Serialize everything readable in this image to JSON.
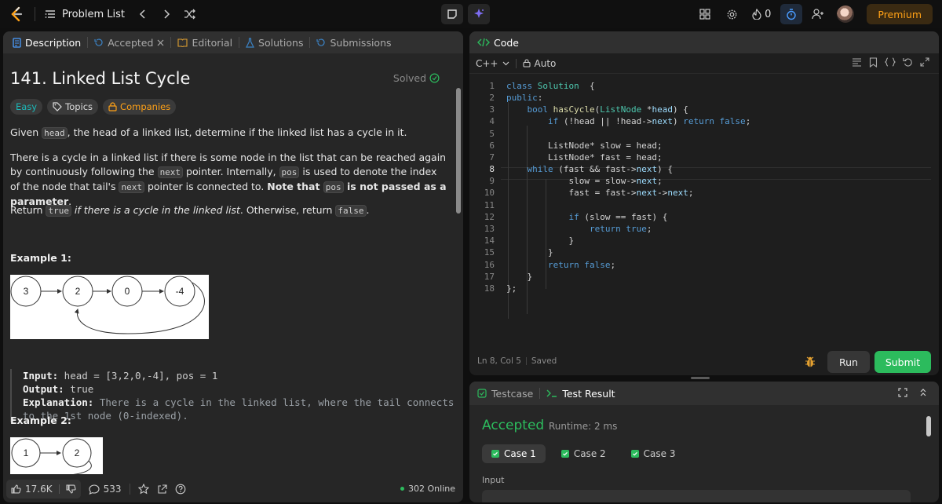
{
  "topbar": {
    "problem_list": "Problem List",
    "streak_count": "0",
    "premium": "Premium"
  },
  "tabs": [
    {
      "label": "Description"
    },
    {
      "label": "Accepted"
    },
    {
      "label": "Editorial"
    },
    {
      "label": "Solutions"
    },
    {
      "label": "Submissions"
    }
  ],
  "problem": {
    "title": "141. Linked List Cycle",
    "status": "Solved",
    "difficulty": "Easy",
    "topics": "Topics",
    "companies": "Companies",
    "desc1_a": "Given ",
    "desc1_code": "head",
    "desc1_b": ", the head of a linked list, determine if the linked list has a cycle in it.",
    "desc2_a": "There is a cycle in a linked list if there is some node in the list that can be reached again by continuously following the ",
    "desc2_code1": "next",
    "desc2_b": " pointer. Internally, ",
    "desc2_code2": "pos",
    "desc2_c": " is used to denote the index of the node that tail's ",
    "desc2_code3": "next",
    "desc2_d": " pointer is connected to. ",
    "desc2_bold1": "Note that ",
    "desc2_code4": "pos",
    "desc2_bold2": " is not passed as a parameter",
    "desc2_e": ".",
    "desc3_a": "Return ",
    "desc3_code1": "true",
    "desc3_italic": " if there is a cycle in the linked list",
    "desc3_b": ". Otherwise, return ",
    "desc3_code2": "false",
    "desc3_c": ".",
    "example1_title": "Example 1:",
    "example1_nodes": [
      "3",
      "2",
      "0",
      "-4"
    ],
    "example1_input_label": "Input:",
    "example1_input": " head = [3,2,0,-4], pos = 1",
    "example1_output_label": "Output:",
    "example1_output": " true",
    "example1_expl_label": "Explanation:",
    "example1_expl": " There is a cycle in the linked list, where the tail connects\nto the 1st node (0-indexed).",
    "example2_title": "Example 2:",
    "example2_nodes": [
      "1",
      "2"
    ]
  },
  "footer": {
    "likes": "17.6K",
    "comments": "533",
    "online": "302 Online"
  },
  "code_panel": {
    "title": "Code",
    "language": "C++",
    "mode": "Auto",
    "line_numbers": [
      "1",
      "2",
      "3",
      "4",
      "5",
      "6",
      "7",
      "8",
      "9",
      "10",
      "11",
      "12",
      "13",
      "14",
      "15",
      "16",
      "17",
      "18"
    ],
    "cursor": "Ln 8, Col 5",
    "saved": "Saved",
    "run": "Run",
    "submit": "Submit"
  },
  "test_panel": {
    "tab_testcase": "Testcase",
    "tab_result": "Test Result",
    "verdict": "Accepted",
    "runtime": "Runtime: 2 ms",
    "cases": [
      "Case 1",
      "Case 2",
      "Case 3"
    ],
    "input_label": "Input"
  },
  "colors": {
    "accent_orange": "#ffa116",
    "success_green": "#2cbb5d",
    "easy_teal": "#1cb8b8"
  }
}
